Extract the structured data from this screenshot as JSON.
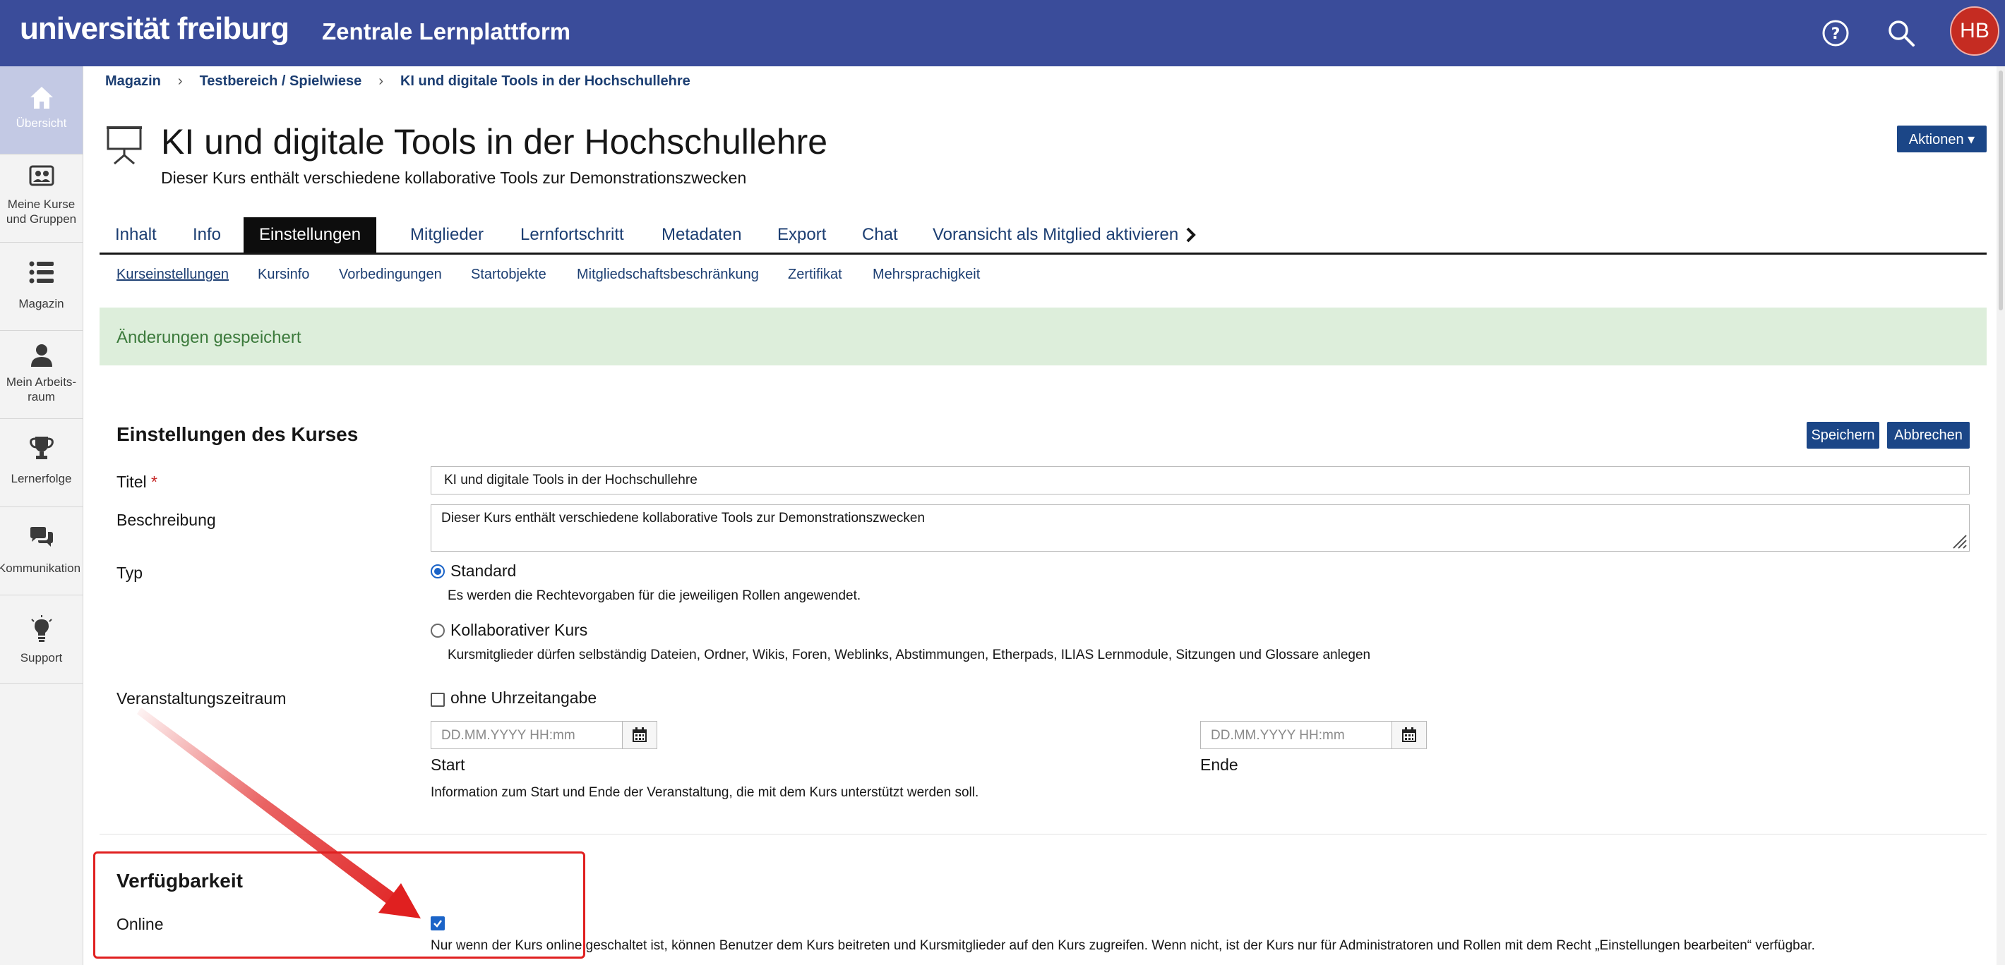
{
  "header": {
    "logo": "universität freiburg",
    "platform_title": "Zentrale Lernplattform",
    "help_icon": "help-circle-icon",
    "search_icon": "search-icon",
    "avatar_initials": "HB",
    "color": "#3a4c9a"
  },
  "leftnav": {
    "items": [
      {
        "label": "Übersicht",
        "icon": "home-icon",
        "active": true
      },
      {
        "label": "Meine Kurse und Gruppen",
        "icon": "group-icon"
      },
      {
        "label": "Magazin",
        "icon": "list-icon"
      },
      {
        "label": "Mein Arbeits-raum",
        "icon": "person-icon"
      },
      {
        "label": "Lernerfolge",
        "icon": "trophy-icon"
      },
      {
        "label": "Kommunikation",
        "icon": "chat-icon"
      },
      {
        "label": "Support",
        "icon": "lightbulb-icon"
      }
    ]
  },
  "breadcrumb": [
    "Magazin",
    "Testbereich / Spielwiese",
    "KI und digitale Tools in der Hochschullehre"
  ],
  "course": {
    "title": "KI und digitale Tools in der Hochschullehre",
    "description": "Dieser Kurs enthält verschiedene kollaborative Tools zur Demonstrationszwecken",
    "icon": "presentation-icon",
    "actions_label": "Aktionen ▾"
  },
  "tabs": [
    "Inhalt",
    "Info",
    "Einstellungen",
    "Mitglieder",
    "Lernfortschritt",
    "Metadaten",
    "Export",
    "Chat",
    "Voransicht als Mitglied aktivieren"
  ],
  "active_tab": "Einstellungen",
  "subtabs": [
    "Kurseinstellungen",
    "Kursinfo",
    "Vorbedingungen",
    "Startobjekte",
    "Mitgliedschaftsbeschränkung",
    "Zertifikat",
    "Mehrsprachigkeit"
  ],
  "message": "Änderungen gespeichert",
  "form": {
    "section_title": "Einstellungen des Kurses",
    "save_label": "Speichern",
    "cancel_label": "Abbrechen",
    "title_label": "Titel",
    "required_mark": "*",
    "title_value": "KI und digitale Tools in der Hochschullehre",
    "description_label": "Beschreibung",
    "description_value": "Dieser Kurs enthält verschiedene kollaborative Tools zur Demonstrationszwecken",
    "type_label": "Typ",
    "type_options": [
      {
        "label": "Standard",
        "help": "Es werden die Rechtevorgaben für die jeweiligen Rollen angewendet.",
        "selected": true
      },
      {
        "label": "Kollaborativer Kurs",
        "help": "Kursmitglieder dürfen selbständig Dateien, Ordner, Wikis, Foren, Weblinks, Abstimmungen, Etherpads, ILIAS Lernmodule, Sitzungen und Glossare anlegen",
        "selected": false
      }
    ],
    "period_label": "Veranstaltungszeitraum",
    "no_time_label": "ohne Uhrzeitangabe",
    "date_placeholder": "DD.MM.YYYY HH:mm",
    "start_label": "Start",
    "end_label": "Ende",
    "period_help": "Information zum Start und Ende der Veranstaltung, die mit dem Kurs unterstützt werden soll.",
    "availability_title": "Verfügbarkeit",
    "online_label": "Online",
    "online_checked": true,
    "online_help": "Nur wenn der Kurs online geschaltet ist, können Benutzer dem Kurs beitreten und Kursmitglieder auf den Kurs zugreifen. Wenn nicht, ist der Kurs nur für Administratoren und Rollen mit dem Recht „Einstellungen bearbeiten“ verfügbar."
  },
  "annotation_color": "#e02020"
}
